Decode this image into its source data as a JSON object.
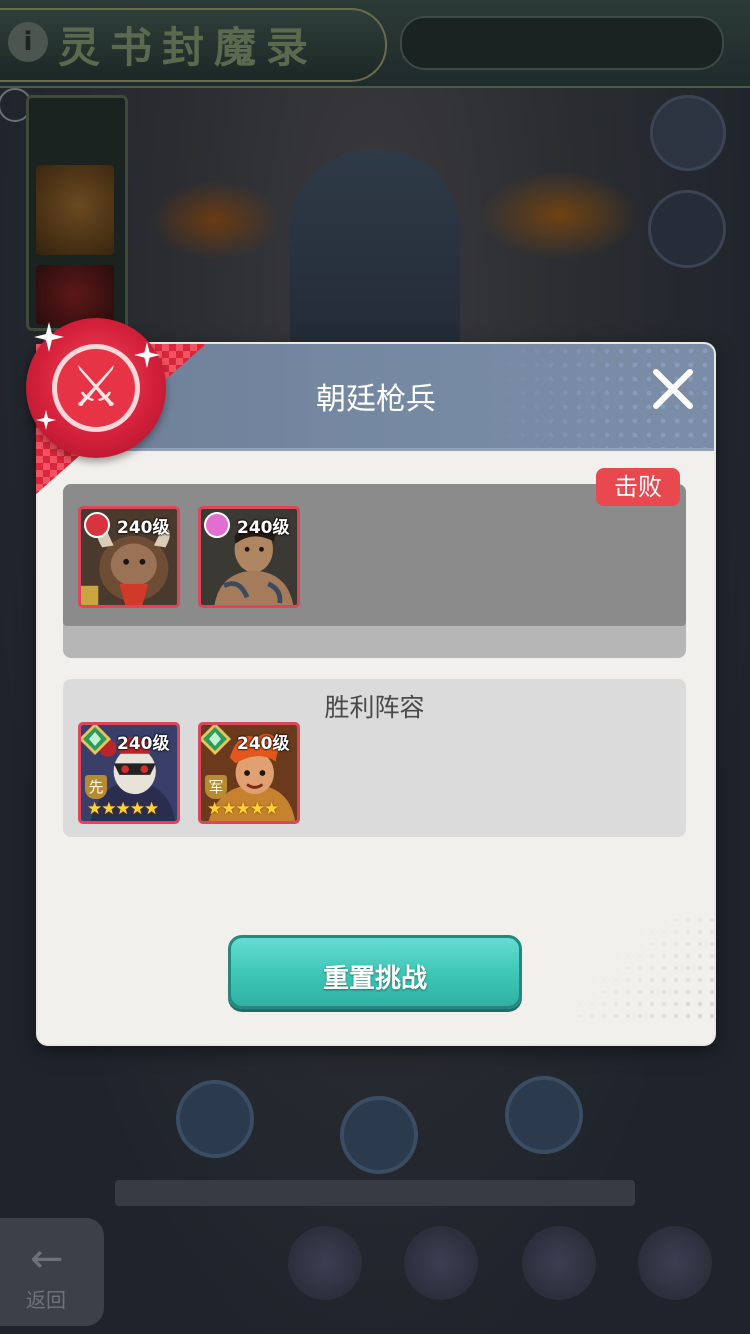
{
  "background": {
    "event_title": "灵书封魔录",
    "back_label": "返回",
    "back_arrow": "←"
  },
  "dialog": {
    "title": "朝廷枪兵",
    "close_icon": "close-icon",
    "emblem_icon": "crossed-swords-icon",
    "emblem_glyph": "⚔",
    "enemy_panel": {
      "status_badge": "击败",
      "heroes": [
        {
          "level": "240级",
          "faction": "red-flower",
          "faction_color": "#d8333f",
          "portrait": "ox-warrior"
        },
        {
          "level": "240级",
          "faction": "pink-heart",
          "faction_color": "#e06fd0",
          "portrait": "tattooed-brawler"
        }
      ]
    },
    "victory_panel": {
      "title": "胜利阵容",
      "heroes": [
        {
          "level": "240级",
          "tag": "先",
          "stars": "★★★★★",
          "rank": "green-diamond",
          "portrait": "masked-general"
        },
        {
          "level": "240级",
          "tag": "军",
          "stars": "★★★★★",
          "rank": "green-diamond",
          "portrait": "fire-haired-warrior"
        }
      ]
    },
    "reset_button": "重置挑战"
  },
  "colors": {
    "header": "#7689a3",
    "defeat_badge": "#e8484e",
    "reset_button": "#3fc7b8",
    "emblem": "#d4203a"
  }
}
